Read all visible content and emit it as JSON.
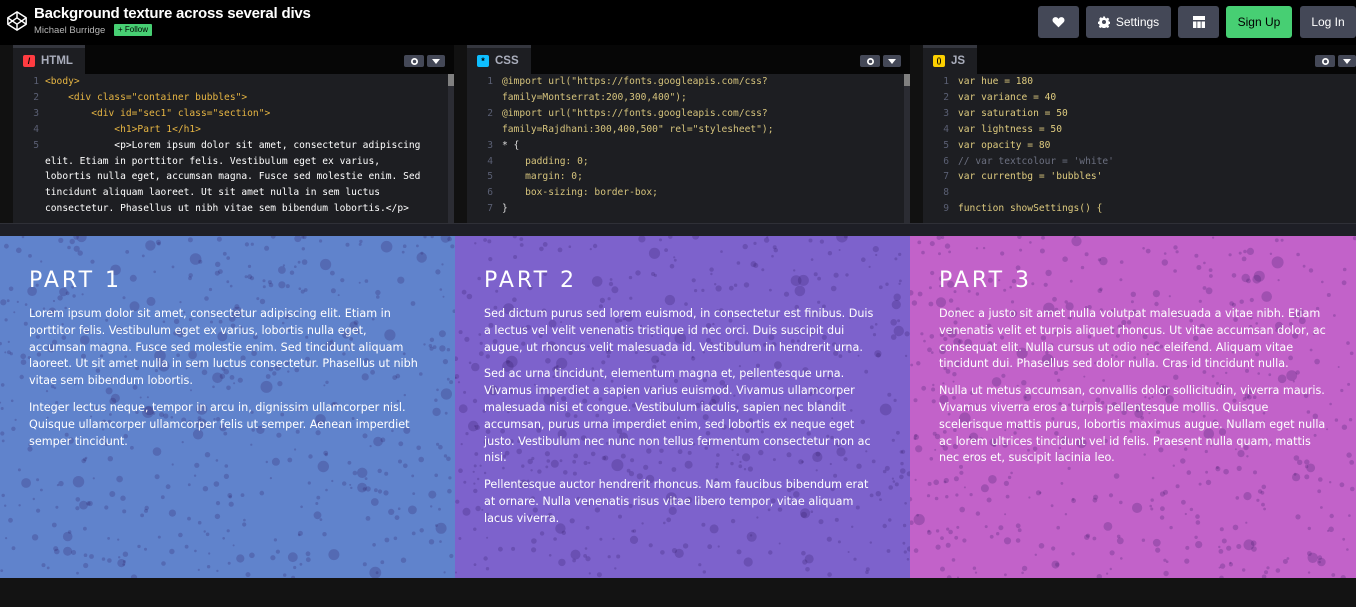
{
  "header": {
    "title": "Background texture across several divs",
    "author": "Michael Burridge",
    "follow_label": "+ Follow",
    "settings_label": "Settings",
    "signup_label": "Sign Up",
    "login_label": "Log In",
    "signup_color": "#47cf73"
  },
  "editors": {
    "html": {
      "label": "HTML",
      "badge": "/",
      "badge_color": "#ff3c41",
      "line_numbers": [
        "1",
        "2",
        "3",
        "4",
        "5",
        "",
        "",
        "",
        "",
        ""
      ]
    },
    "css": {
      "label": "CSS",
      "badge": "*",
      "badge_color": "#0ebeff",
      "line_numbers": [
        "1",
        "",
        "2",
        "",
        "3",
        "4",
        "5",
        "6",
        "7"
      ]
    },
    "js": {
      "label": "JS",
      "badge": "()",
      "badge_color": "#fcd000",
      "line_numbers": [
        "1",
        "2",
        "3",
        "4",
        "5",
        "6",
        "7",
        "8",
        "9"
      ]
    }
  },
  "code": {
    "html": [
      "<body>",
      "    <div class=\"container bubbles\">",
      "        <div id=\"sec1\" class=\"section\">",
      "            <h1>Part 1</h1>",
      "            <p>Lorem ipsum dolor sit amet, consectetur adipiscing",
      "elit. Etiam in porttitor felis. Vestibulum eget ex varius,",
      "lobortis nulla eget, accumsan magna. Fusce sed molestie enim. Sed",
      "tincidunt aliquam laoreet. Ut sit amet nulla in sem luctus",
      "consectetur. Phasellus ut nibh vitae sem bibendum lobortis.</p>"
    ],
    "css": [
      "@import url(\"https://fonts.googleapis.com/css?",
      "family=Montserrat:200,300,400\");",
      "@import url(\"https://fonts.googleapis.com/css?",
      "family=Rajdhani:300,400,500\" rel=\"stylesheet\");",
      "* {",
      "    padding: 0;",
      "    margin: 0;",
      "    box-sizing: border-box;",
      "}"
    ],
    "js": [
      "var hue = 180",
      "var variance = 40",
      "var saturation = 50",
      "var lightness = 50",
      "var opacity = 80",
      "// var textcolour = 'white'",
      "var currentbg = 'bubbles'",
      "",
      "function showSettings() {"
    ]
  },
  "sections": [
    {
      "title": "PART 1",
      "bg_color": "#6083cc",
      "paragraphs": [
        "Lorem ipsum dolor sit amet, consectetur adipiscing elit. Etiam in porttitor felis. Vestibulum eget ex varius, lobortis nulla eget, accumsan magna. Fusce sed molestie enim. Sed tincidunt aliquam laoreet. Ut sit amet nulla in sem luctus consectetur. Phasellus ut nibh vitae sem bibendum lobortis.",
        "Integer lectus neque, tempor in arcu in, dignissim ullamcorper nisl. Quisque ullamcorper ullamcorper felis ut semper. Aenean imperdiet semper tincidunt."
      ]
    },
    {
      "title": "PART 2",
      "bg_color": "#7d62cc",
      "paragraphs": [
        "Sed dictum purus sed lorem euismod, in consectetur est finibus. Duis a lectus vel velit venenatis tristique id nec orci. Duis suscipit dui augue, ut rhoncus velit malesuada id. Vestibulum in hendrerit urna.",
        "Sed ac urna tincidunt, elementum magna et, pellentesque urna. Vivamus imperdiet a sapien varius euismod. Vivamus ullamcorper malesuada nisi et congue. Vestibulum iaculis, sapien nec blandit accumsan, purus urna imperdiet enim, sed lobortis ex neque eget justo. Vestibulum nec nunc non tellus fermentum consectetur non ac nisi.",
        "Pellentesque auctor hendrerit rhoncus. Nam faucibus bibendum erat at ornare. Nulla venenatis risus vitae libero tempor, vitae aliquam lacus viverra."
      ]
    },
    {
      "title": "PART 3",
      "bg_color": "#c262c9",
      "paragraphs": [
        "Donec a justo sit amet nulla volutpat malesuada a vitae nibh. Etiam venenatis velit et turpis aliquet rhoncus. Ut vitae accumsan dolor, ac consequat elit. Nulla cursus ut odio nec eleifend. Aliquam vitae tincidunt dui. Phasellus sed dolor nulla. Cras id tincidunt nulla.",
        "Nulla ut metus accumsan, convallis dolor sollicitudin, viverra mauris. Vivamus viverra eros a turpis pellentesque mollis. Quisque scelerisque mattis purus, lobortis maximus augue. Nullam eget nulla ac lorem ultrices tincidunt vel id felis. Praesent nulla quam, mattis nec eros et, suscipit lacinia leo."
      ]
    }
  ]
}
